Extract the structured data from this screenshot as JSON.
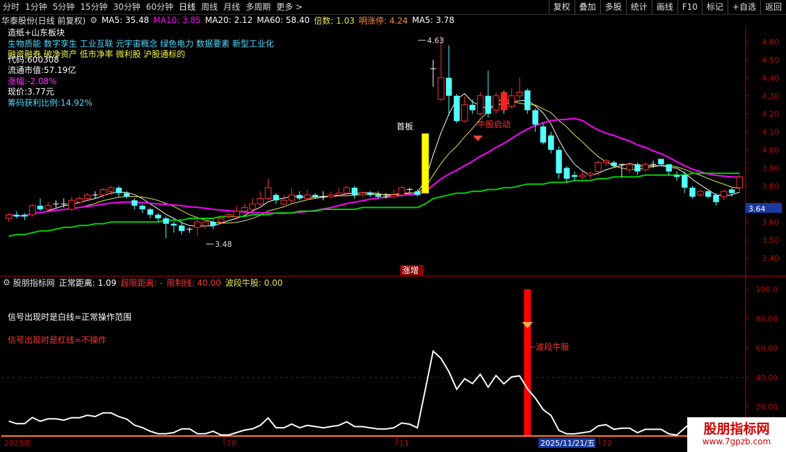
{
  "toolbar": {
    "periods": [
      "分时",
      "1分钟",
      "5分钟",
      "15分钟",
      "30分钟",
      "60分钟",
      "日线",
      "周线",
      "月线",
      "多周期",
      "更多 >"
    ],
    "active_period": "日线",
    "right_tools": [
      "复权",
      "叠加",
      "多股",
      "统计",
      "画线",
      "F10",
      "标记",
      "+自选",
      "返回"
    ]
  },
  "header": {
    "title": "华泰股份(日线 前复权)",
    "ma5": "MA5: 35.48",
    "ma10": "MA10: 3.85",
    "ma20": "MA20: 2.12",
    "ma60": "MA60: 58.40",
    "beishu": "倍数: 1.03",
    "mingzhangting": "明涨停: 4.24",
    "ma5b": "MA5: 3.78"
  },
  "info": {
    "line1": "造纸+山东板块",
    "line2": "生物质能 数字孪生 工业互联 元宇宙概念 绿色电力 数据要素 新型工业化",
    "line3": "融资融券 破净资产 低市净率 微利股 沪股通标的",
    "line4": "代码:600308",
    "line5": "流通市值:57.19亿",
    "line6": "涨幅:-2.08%",
    "line7": "现价:3.77元",
    "line8": "筹码获利比例:14.92%"
  },
  "annotations": {
    "high": "4.63",
    "low": "3.48",
    "first_board": "首板",
    "bull_start": "牛股启动",
    "zengzhang": "涨增",
    "current_price_tag": "3.64",
    "wave_bull": "波段牛股",
    "note_white": "信号出现时是白线=正常操作范围",
    "note_red": "信号出现时是红线=不操作"
  },
  "sub_header": {
    "title": "股朋指标网",
    "normal": "正常距离: 1.09",
    "over": "超限距离: -",
    "limit": "限制线: 40.00",
    "wave": "波段牛股: 0.00"
  },
  "price_axis": [
    "4.60",
    "4.50",
    "4.40",
    "4.30",
    "4.20",
    "4.10",
    "4.00",
    "3.90",
    "3.80",
    "3.70",
    "3.60",
    "3.50",
    "3.40"
  ],
  "sub_axis": [
    "100.0",
    "80.00",
    "60.00",
    "40.00",
    "20.00"
  ],
  "date_axis": {
    "year": "2025年",
    "m10": "10",
    "m11": "11",
    "cursor_date": "2025/11/21/五",
    "m12": "12"
  },
  "logo": {
    "line1": "股朋指标网",
    "line2": "www.7gpzb.com"
  },
  "colors": {
    "up": "#ff3232",
    "down": "#54ffff",
    "ma5": "#ffffff",
    "ma10": "#e6e65a",
    "ma20": "#ff00ff",
    "ma60": "#00d200",
    "axis": "#c80000"
  },
  "chart_data": {
    "type": "candlestick",
    "candles": [
      [
        3.62,
        3.64,
        3.6,
        3.65
      ],
      [
        3.64,
        3.63,
        3.62,
        3.66
      ],
      [
        3.64,
        3.63,
        3.61,
        3.65
      ],
      [
        3.64,
        3.69,
        3.63,
        3.7
      ],
      [
        3.69,
        3.67,
        3.66,
        3.73
      ],
      [
        3.67,
        3.69,
        3.65,
        3.71
      ],
      [
        3.7,
        3.7,
        3.68,
        3.72
      ],
      [
        3.7,
        3.7,
        3.68,
        3.73
      ],
      [
        3.67,
        3.72,
        3.66,
        3.74
      ],
      [
        3.71,
        3.73,
        3.7,
        3.74
      ],
      [
        3.73,
        3.75,
        3.72,
        3.76
      ],
      [
        3.75,
        3.75,
        3.73,
        3.77
      ],
      [
        3.75,
        3.78,
        3.73,
        3.79
      ],
      [
        3.77,
        3.79,
        3.75,
        3.8
      ],
      [
        3.79,
        3.76,
        3.74,
        3.8
      ],
      [
        3.76,
        3.74,
        3.73,
        3.77
      ],
      [
        3.72,
        3.69,
        3.67,
        3.73
      ],
      [
        3.69,
        3.67,
        3.65,
        3.7
      ],
      [
        3.67,
        3.64,
        3.62,
        3.68
      ],
      [
        3.64,
        3.62,
        3.6,
        3.65
      ],
      [
        3.62,
        3.59,
        3.51,
        3.63
      ],
      [
        3.59,
        3.58,
        3.54,
        3.6
      ],
      [
        3.58,
        3.55,
        3.53,
        3.6
      ],
      [
        3.56,
        3.56,
        3.54,
        3.57
      ],
      [
        3.57,
        3.6,
        3.52,
        3.62
      ],
      [
        3.58,
        3.6,
        3.56,
        3.61
      ],
      [
        3.6,
        3.58,
        3.56,
        3.61
      ],
      [
        3.6,
        3.62,
        3.59,
        3.63
      ],
      [
        3.63,
        3.64,
        3.62,
        3.65
      ],
      [
        3.63,
        3.66,
        3.62,
        3.69
      ],
      [
        3.66,
        3.68,
        3.65,
        3.7
      ],
      [
        3.67,
        3.7,
        3.66,
        3.73
      ],
      [
        3.7,
        3.73,
        3.69,
        3.77
      ],
      [
        3.73,
        3.79,
        3.72,
        3.84
      ],
      [
        3.75,
        3.72,
        3.7,
        3.76
      ],
      [
        3.7,
        3.72,
        3.69,
        3.75
      ],
      [
        3.72,
        3.75,
        3.7,
        3.79
      ],
      [
        3.75,
        3.73,
        3.72,
        3.77
      ],
      [
        3.73,
        3.75,
        3.72,
        3.78
      ],
      [
        3.75,
        3.74,
        3.73,
        3.76
      ],
      [
        3.74,
        3.74,
        3.72,
        3.77
      ],
      [
        3.74,
        3.75,
        3.73,
        3.77
      ],
      [
        3.75,
        3.76,
        3.74,
        3.79
      ],
      [
        3.76,
        3.79,
        3.75,
        3.8
      ],
      [
        3.79,
        3.75,
        3.73,
        3.8
      ],
      [
        3.75,
        3.76,
        3.74,
        3.77
      ],
      [
        3.76,
        3.75,
        3.74,
        3.77
      ],
      [
        3.75,
        3.74,
        3.73,
        3.77
      ],
      [
        3.74,
        3.74,
        3.73,
        3.76
      ],
      [
        3.74,
        3.75,
        3.73,
        3.78
      ],
      [
        3.75,
        3.79,
        3.74,
        3.8
      ],
      [
        3.78,
        3.78,
        3.76,
        3.79
      ],
      [
        3.77,
        3.75,
        3.74,
        3.78
      ],
      [
        3.76,
        4.09,
        3.76,
        4.09
      ],
      [
        4.45,
        4.45,
        4.35,
        4.5
      ],
      [
        4.28,
        4.4,
        4.27,
        4.63
      ],
      [
        4.4,
        4.3,
        4.19,
        4.58
      ],
      [
        4.3,
        4.16,
        4.15,
        4.31
      ],
      [
        4.16,
        4.25,
        4.15,
        4.3
      ],
      [
        4.25,
        4.22,
        4.2,
        4.28
      ],
      [
        4.2,
        4.3,
        4.19,
        4.32
      ],
      [
        4.3,
        4.2,
        4.18,
        4.44
      ],
      [
        4.22,
        4.3,
        4.2,
        4.32
      ],
      [
        4.32,
        4.24,
        4.2,
        4.33
      ],
      [
        4.24,
        4.3,
        4.23,
        4.34
      ],
      [
        4.3,
        4.32,
        4.28,
        4.4
      ],
      [
        4.33,
        4.22,
        4.2,
        4.34
      ],
      [
        4.22,
        4.14,
        4.1,
        4.23
      ],
      [
        4.13,
        4.04,
        4.03,
        4.15
      ],
      [
        4.08,
        4.0,
        3.98,
        4.1
      ],
      [
        4.0,
        3.87,
        3.84,
        4.02
      ],
      [
        3.9,
        3.84,
        3.82,
        3.91
      ],
      [
        3.86,
        3.85,
        3.83,
        3.88
      ],
      [
        3.85,
        3.86,
        3.84,
        3.88
      ],
      [
        3.86,
        3.87,
        3.84,
        3.88
      ],
      [
        3.88,
        3.93,
        3.86,
        3.94
      ],
      [
        3.93,
        3.94,
        3.91,
        3.95
      ],
      [
        3.93,
        3.91,
        3.9,
        3.94
      ],
      [
        3.92,
        3.92,
        3.85,
        3.92
      ],
      [
        3.89,
        3.92,
        3.87,
        3.93
      ],
      [
        3.92,
        3.88,
        3.86,
        3.93
      ],
      [
        3.89,
        3.92,
        3.88,
        3.93
      ],
      [
        3.92,
        3.92,
        3.9,
        3.94
      ],
      [
        3.95,
        3.92,
        3.91,
        3.95
      ],
      [
        3.92,
        3.88,
        3.86,
        3.92
      ],
      [
        3.86,
        3.85,
        3.83,
        3.88
      ],
      [
        3.86,
        3.79,
        3.76,
        3.88
      ],
      [
        3.79,
        3.74,
        3.73,
        3.8
      ],
      [
        3.75,
        3.77,
        3.74,
        3.78
      ],
      [
        3.77,
        3.74,
        3.73,
        3.78
      ],
      [
        3.75,
        3.71,
        3.69,
        3.76
      ],
      [
        3.74,
        3.77,
        3.72,
        3.78
      ],
      [
        3.78,
        3.76,
        3.74,
        3.79
      ],
      [
        3.79,
        3.85,
        3.77,
        3.86
      ]
    ],
    "ma60": [
      3.52,
      3.53,
      3.53,
      3.54,
      3.55,
      3.55,
      3.56,
      3.57,
      3.57,
      3.58,
      3.58,
      3.59,
      3.59,
      3.6,
      3.6,
      3.6,
      3.6,
      3.6,
      3.6,
      3.6,
      3.61,
      3.61,
      3.61,
      3.62,
      3.62,
      3.62,
      3.62,
      3.63,
      3.63,
      3.63,
      3.63,
      3.64,
      3.64,
      3.64,
      3.65,
      3.65,
      3.65,
      3.66,
      3.66,
      3.66,
      3.67,
      3.67,
      3.67,
      3.67,
      3.67,
      3.68,
      3.68,
      3.68,
      3.68,
      3.68,
      3.68,
      3.68,
      3.68,
      3.7,
      3.73,
      3.74,
      3.75,
      3.76,
      3.76,
      3.77,
      3.77,
      3.78,
      3.78,
      3.79,
      3.79,
      3.8,
      3.81,
      3.81,
      3.81,
      3.82,
      3.82,
      3.82,
      3.83,
      3.83,
      3.83,
      3.84,
      3.84,
      3.85,
      3.85,
      3.85,
      3.85,
      3.86,
      3.86,
      3.86,
      3.86,
      3.86,
      3.86,
      3.87,
      3.87,
      3.87,
      3.87,
      3.87,
      3.87,
      3.87
    ],
    "subchart": {
      "axis": [
        0,
        100
      ],
      "limit": 40,
      "signal_index": 66,
      "signal_value": 100
    }
  }
}
